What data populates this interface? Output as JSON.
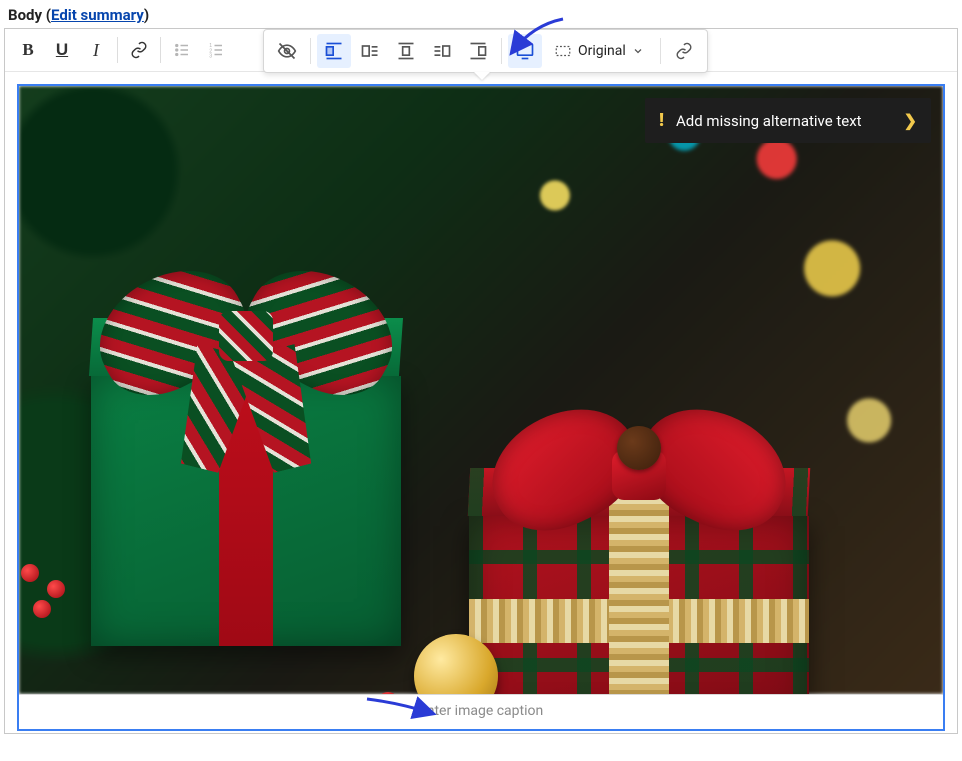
{
  "field": {
    "label": "Body",
    "edit_summary_link": "Edit summary"
  },
  "main_toolbar": {
    "bold_glyph": "B",
    "underline_glyph": "U",
    "italic_glyph": "I"
  },
  "float_toolbar": {
    "size_label": "Original"
  },
  "alt_banner": {
    "text": "Add missing alternative text"
  },
  "caption": {
    "placeholder": "Enter image caption"
  }
}
